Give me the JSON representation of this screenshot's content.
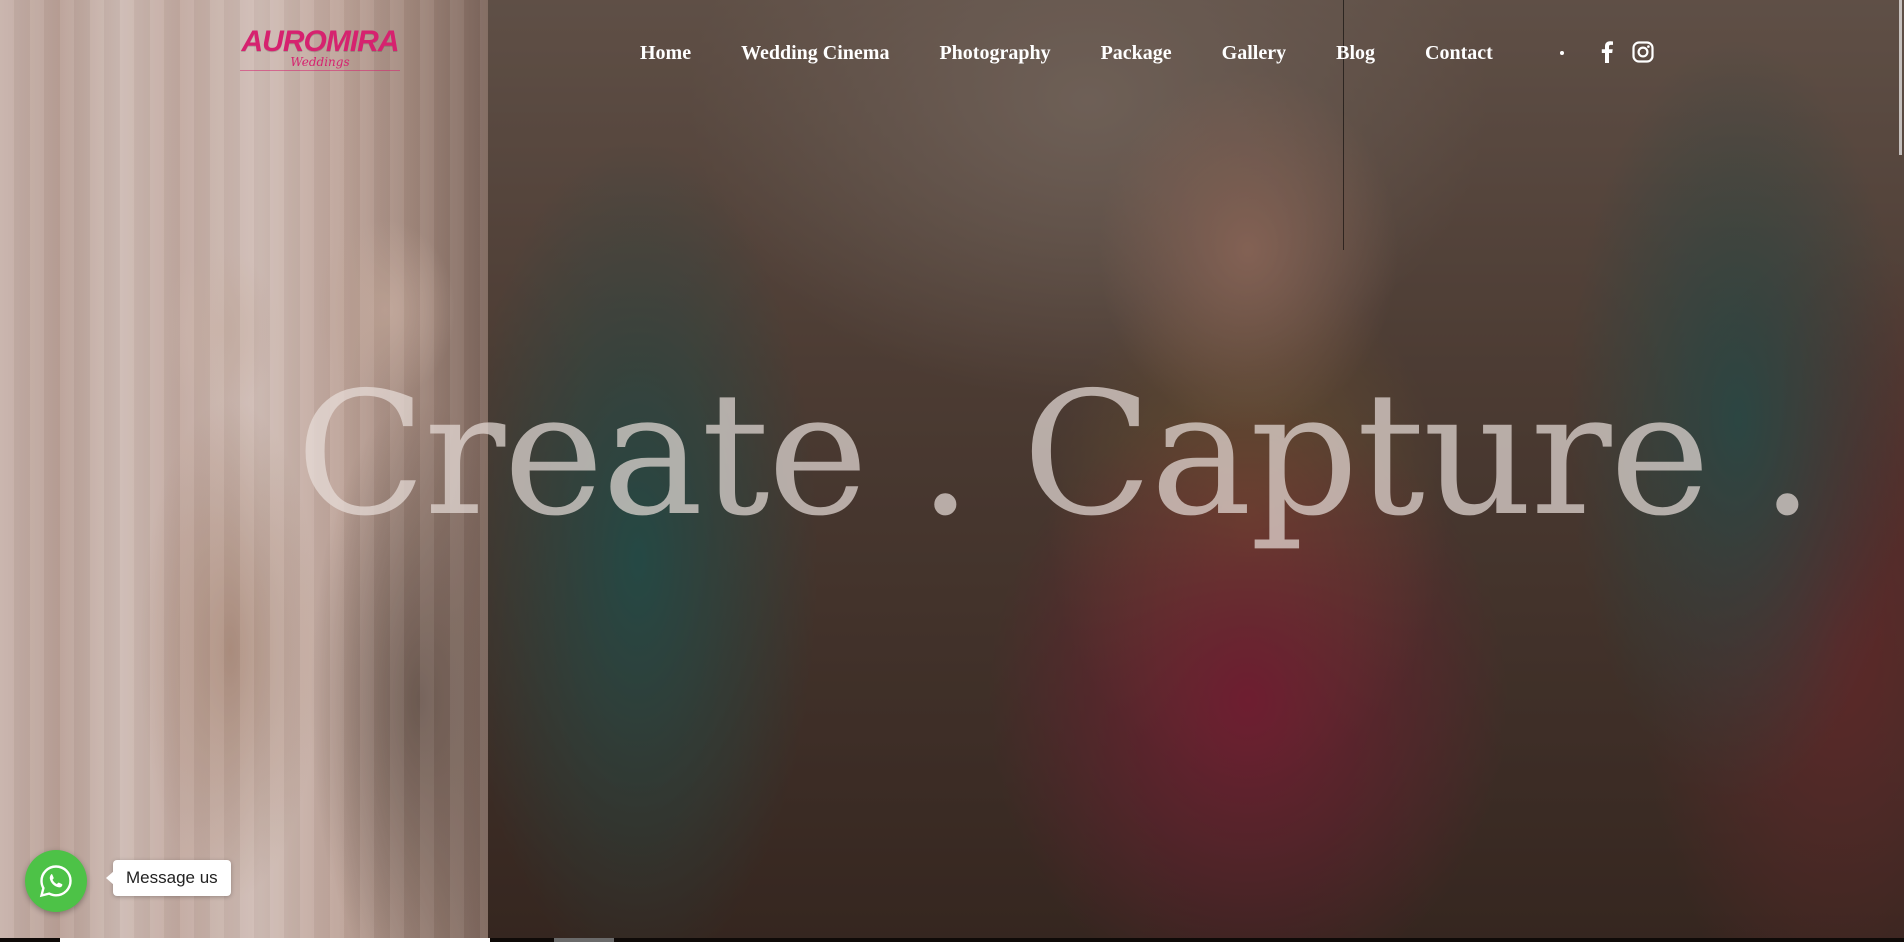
{
  "brand": {
    "logo_text": "AUROMIRA",
    "logo_subtext": "Weddings",
    "color": "#d6226f"
  },
  "nav": {
    "items": [
      {
        "label": "Home"
      },
      {
        "label": "Wedding Cinema"
      },
      {
        "label": "Photography"
      },
      {
        "label": "Package"
      },
      {
        "label": "Gallery"
      },
      {
        "label": "Blog"
      },
      {
        "label": "Contact"
      }
    ]
  },
  "social": {
    "icons": [
      "facebook-icon",
      "instagram-icon"
    ]
  },
  "hero": {
    "headline": "Create . Capture .",
    "images": [
      "sepia-couple-photo",
      "bride-in-red-lehenga-photo"
    ]
  },
  "whatsapp": {
    "label": "Message us",
    "color": "#4dc247",
    "icon": "whatsapp-icon"
  },
  "slider": {
    "progress_color": "#ffffff"
  }
}
